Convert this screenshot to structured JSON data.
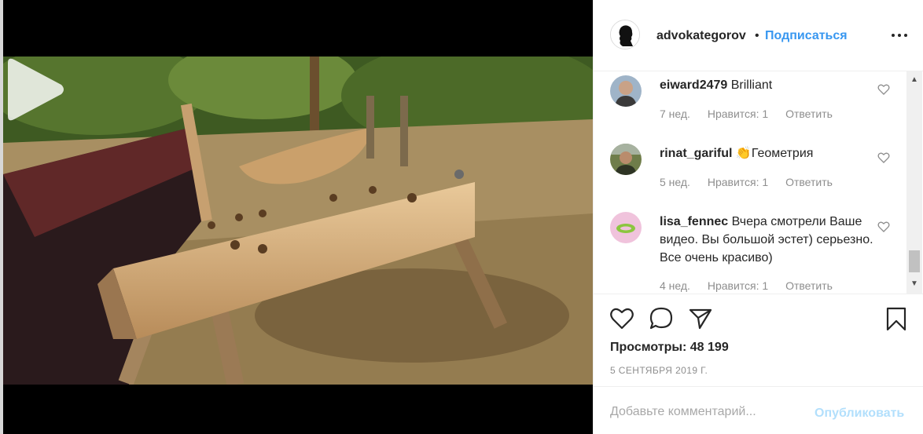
{
  "post": {
    "author": "advokategorov",
    "separator": "•",
    "follow_label": "Подписаться"
  },
  "comments": [
    {
      "user": "eiward2479",
      "text": "Brilliant",
      "age": "7 нед.",
      "likes": "Нравится: 1",
      "reply": "Ответить"
    },
    {
      "user": "rinat_gariful",
      "text": "👏Геометрия",
      "age": "5 нед.",
      "likes": "Нравится: 1",
      "reply": "Ответить"
    },
    {
      "user": "lisa_fennec",
      "text": "Вчера смотрели Ваше видео. Вы большой эстет) серьезно. Все очень красиво)",
      "age": "4 нед.",
      "likes": "Нравится: 1",
      "reply": "Ответить"
    }
  ],
  "stats": {
    "views": "Просмотры: 48 199",
    "date": "5 СЕНТЯБРЯ 2019 Г."
  },
  "composer": {
    "placeholder": "Добавьте комментарий...",
    "publish_label": "Опубликовать"
  },
  "icons": {
    "more": "more-horizontal-icon",
    "play": "play-icon",
    "like": "heart-icon",
    "comment": "comment-bubble-icon",
    "share": "paper-plane-icon",
    "save": "bookmark-icon"
  },
  "colors": {
    "accent": "#3897f0",
    "publish_disabled": "#b2dffc",
    "secondary_text": "#8e8e8e"
  }
}
